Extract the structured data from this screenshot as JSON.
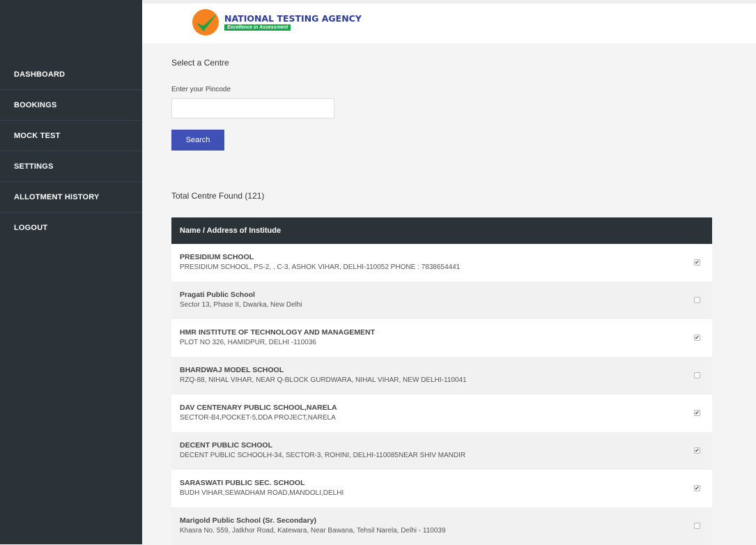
{
  "sidebar": {
    "items": [
      {
        "label": "DASHBOARD"
      },
      {
        "label": "BOOKINGS"
      },
      {
        "label": "MOCK TEST"
      },
      {
        "label": "SETTINGS"
      },
      {
        "label": "ALLOTMENT HISTORY"
      },
      {
        "label": "LOGOUT"
      }
    ]
  },
  "header": {
    "org_name": "NATIONAL TESTING AGENCY",
    "tagline": "Excellence in Assessment",
    "brand_colors": {
      "primary": "#2c3c95",
      "accent": "#1aa447",
      "logo_orange": "#f5821f"
    }
  },
  "main": {
    "section_title": "Select a Centre",
    "pincode_label": "Enter your Pincode",
    "pincode_value": "",
    "search_label": "Search",
    "total_label": "Total Centre Found (121)",
    "table_header": "Name / Address of Institude",
    "centres": [
      {
        "name": "PRESIDIUM SCHOOL",
        "address": "PRESIDIUM SCHOOL, PS-2, , C-3, ASHOK VIHAR, DELHI-110052 PHONE : 7838654441",
        "checked": true
      },
      {
        "name": "Pragati Public School",
        "address": "Sector 13, Phase II, Dwarka, New Delhi",
        "checked": false
      },
      {
        "name": "HMR INSTITUTE OF TECHNOLOGY AND MANAGEMENT",
        "address": "PLOT NO 326, HAMIDPUR, DELHI -110036",
        "checked": true
      },
      {
        "name": "BHARDWAJ MODEL SCHOOL",
        "address": "RZQ-88, NIHAL VIHAR, NEAR Q-BLOCK GURDWARA, NIHAL VIHAR, NEW DELHI-110041",
        "checked": false
      },
      {
        "name": "DAV CENTENARY PUBLIC SCHOOL,NARELA",
        "address": "SECTOR-B4,POCKET-5,DDA PROJECT,NARELA",
        "checked": true
      },
      {
        "name": "DECENT PUBLIC SCHOOL",
        "address": "DECENT PUBLIC SCHOOLH-34, SECTOR-3, ROHINI, DELHI-110085NEAR SHIV MANDIR",
        "checked": true
      },
      {
        "name": "SARASWATI PUBLIC SEC. SCHOOL",
        "address": "BUDH VIHAR,SEWADHAM ROAD,MANDOLI,DELHI",
        "checked": true
      },
      {
        "name": "Marigold Public School (Sr. Secondary)",
        "address": "Khasra No. 559, Jatkhor Road, Katewara, Near Bawana, Tehsil Narela, Delhi - 110039",
        "checked": false
      }
    ]
  }
}
